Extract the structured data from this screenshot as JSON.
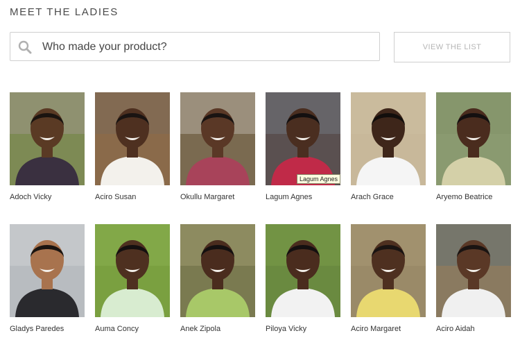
{
  "heading": "MEET THE LADIES",
  "search": {
    "placeholder": "Who made your product?"
  },
  "view_list_label": "VIEW THE LIST",
  "tooltip": "Lagum Agnes",
  "ladies": [
    {
      "name": "Adoch Vicky",
      "bg": "#7d8a54",
      "skin": "#5a3a24",
      "hair": "#1b1410",
      "top": "#3a3040",
      "accent": "#c9a6c4"
    },
    {
      "name": "Aciro Susan",
      "bg": "#8a6a4a",
      "skin": "#4e3020",
      "hair": "#1a1412",
      "top": "#f3f1ec",
      "accent": "#6b6b6b"
    },
    {
      "name": "Okullu Margaret",
      "bg": "#7a6a50",
      "skin": "#5a3826",
      "hair": "#1a1412",
      "top": "#a8435a",
      "accent": "#ffffff"
    },
    {
      "name": "Lagum Agnes",
      "bg": "#5a5050",
      "skin": "#4a2e20",
      "hair": "#141010",
      "top": "#c02a48",
      "accent": "#8aa0b0"
    },
    {
      "name": "Arach Grace",
      "bg": "#c8b89a",
      "skin": "#3e261a",
      "hair": "#120e0c",
      "top": "#f5f5f5",
      "accent": "#d0c4a8"
    },
    {
      "name": "Aryemo Beatrice",
      "bg": "#8a9a70",
      "skin": "#4a2c1e",
      "hair": "#141010",
      "top": "#d4d0a8",
      "accent": "#7a8a60"
    },
    {
      "name": "Gladys Paredes",
      "bg": "#b8bcc0",
      "skin": "#a8734e",
      "hair": "#1a1410",
      "top": "#2a2a2e",
      "accent": "#e8e8e8"
    },
    {
      "name": "Auma Concy",
      "bg": "#7aa040",
      "skin": "#4e3020",
      "hair": "#141010",
      "top": "#d8ecd0",
      "accent": "#9ac060"
    },
    {
      "name": "Anek Zipola",
      "bg": "#7a7a50",
      "skin": "#4a2c1e",
      "hair": "#141010",
      "top": "#a8c868",
      "accent": "#c8c090"
    },
    {
      "name": "Piloya Vicky",
      "bg": "#6a8a40",
      "skin": "#4a2c1e",
      "hair": "#141010",
      "top": "#f2f2f2",
      "accent": "#8ab050"
    },
    {
      "name": "Aciro Margaret",
      "bg": "#9a8a68",
      "skin": "#4e3020",
      "hair": "#1a1412",
      "top": "#e8d870",
      "accent": "#b8a880"
    },
    {
      "name": "Aciro Aidah",
      "bg": "#8a7a60",
      "skin": "#5a3826",
      "hair": "#1a1412",
      "top": "#f0f0f0",
      "accent": "#3a6a8a"
    }
  ]
}
